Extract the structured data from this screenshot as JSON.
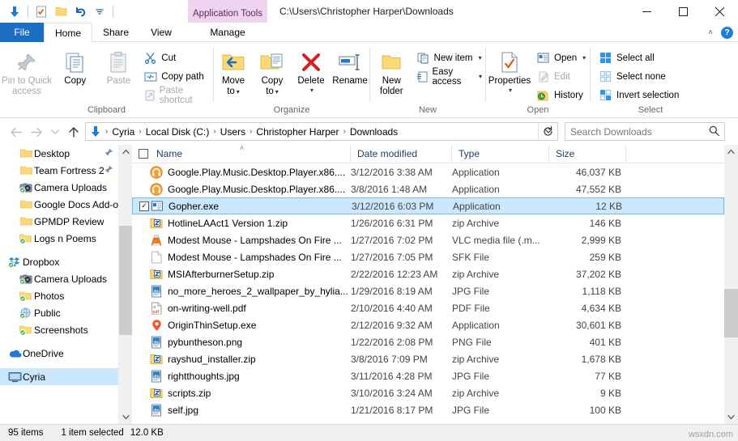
{
  "window": {
    "title": "C:\\Users\\Christopher Harper\\Downloads",
    "app_tools_label": "Application Tools",
    "minimize": "—",
    "maximize": "☐",
    "close": "✕"
  },
  "quick_access": [
    {
      "name": "down-arrow-icon",
      "glyph": "↓"
    },
    {
      "name": "properties-icon",
      "glyph": "☑"
    },
    {
      "name": "new-folder-icon",
      "glyph": "▭"
    },
    {
      "name": "undo-icon",
      "glyph": "↶"
    },
    {
      "name": "customize-icon",
      "glyph": "⌄"
    }
  ],
  "tabs": [
    {
      "label": "File",
      "key": "file"
    },
    {
      "label": "Home",
      "key": "home"
    },
    {
      "label": "Share",
      "key": "share"
    },
    {
      "label": "View",
      "key": "view"
    },
    {
      "label": "Manage",
      "key": "manage"
    }
  ],
  "ribbon_right": {
    "collapse": "˄",
    "help": "?"
  },
  "ribbon": {
    "clipboard": {
      "label": "Clipboard",
      "pin_line1": "Pin to Quick",
      "pin_line2": "access",
      "copy": "Copy",
      "paste": "Paste",
      "cut": "Cut",
      "copy_path": "Copy path",
      "paste_shortcut": "Paste shortcut"
    },
    "organize": {
      "label": "Organize",
      "move_to_line1": "Move",
      "move_to_line2": "to",
      "copy_to_line1": "Copy",
      "copy_to_line2": "to",
      "delete": "Delete",
      "rename": "Rename"
    },
    "new": {
      "label": "New",
      "new_folder_line1": "New",
      "new_folder_line2": "folder",
      "new_item": "New item",
      "easy_access": "Easy access"
    },
    "open": {
      "label": "Open",
      "properties": "Properties",
      "open": "Open",
      "edit": "Edit",
      "history": "History"
    },
    "select": {
      "label": "Select",
      "select_all": "Select all",
      "select_none": "Select none",
      "invert_selection": "Invert selection"
    }
  },
  "addressbar": {
    "back": "←",
    "forward": "→",
    "recent": "⌄",
    "up": "↑",
    "crumbs": [
      "Cyria",
      "Local Disk (C:)",
      "Users",
      "Christopher Harper",
      "Downloads"
    ],
    "separator": "›",
    "dropdown": "⌄",
    "refresh": "↻",
    "search_placeholder": "Search Downloads",
    "search_value": "",
    "search_icon": "⌕"
  },
  "navpane": {
    "items": [
      {
        "label": "Desktop",
        "icon": "folder",
        "pinned": true,
        "indent": 1
      },
      {
        "label": "Team Fortress 2",
        "icon": "folder",
        "pinned": true,
        "indent": 1
      },
      {
        "label": "Camera Uploads",
        "icon": "camera",
        "pinned": false,
        "indent": 1
      },
      {
        "label": "Google Docs Add-ons",
        "icon": "folder",
        "pinned": false,
        "indent": 1
      },
      {
        "label": "GPMDP Review",
        "icon": "folder",
        "pinned": false,
        "indent": 1
      },
      {
        "label": "Logs n Poems",
        "icon": "folder-sync",
        "pinned": false,
        "indent": 1
      },
      {
        "label": "",
        "icon": "spacer",
        "pinned": false,
        "indent": 0
      },
      {
        "label": "Dropbox",
        "icon": "dropbox",
        "pinned": false,
        "indent": 0
      },
      {
        "label": "Camera Uploads",
        "icon": "camera",
        "pinned": false,
        "indent": 1
      },
      {
        "label": "Photos",
        "icon": "folder-sync",
        "pinned": false,
        "indent": 1
      },
      {
        "label": "Public",
        "icon": "globe-sync",
        "pinned": false,
        "indent": 1
      },
      {
        "label": "Screenshots",
        "icon": "folder-sync",
        "pinned": false,
        "indent": 1
      },
      {
        "label": "",
        "icon": "spacer",
        "pinned": false,
        "indent": 0
      },
      {
        "label": "OneDrive",
        "icon": "onedrive",
        "pinned": false,
        "indent": 0
      },
      {
        "label": "",
        "icon": "spacer",
        "pinned": false,
        "indent": 0
      },
      {
        "label": "Cyria",
        "icon": "monitor",
        "pinned": false,
        "indent": 0,
        "selected": true
      }
    ],
    "scroll_up": "˄",
    "scroll_down": "˅"
  },
  "filelist": {
    "columns": [
      "Name",
      "Date modified",
      "Type",
      "Size"
    ],
    "sort_indicator": "˄",
    "scroll_up": "˄",
    "scroll_down": "˅",
    "rows": [
      {
        "name": "Google.Play.Music.Desktop.Player.x86....",
        "date": "3/12/2016 3:38 AM",
        "type": "Application",
        "size": "46,037 KB",
        "icon": "gpmdp",
        "selected": false,
        "checked": false
      },
      {
        "name": "Google.Play.Music.Desktop.Player.x86....",
        "date": "3/8/2016 1:48 AM",
        "type": "Application",
        "size": "47,552 KB",
        "icon": "gpmdp",
        "selected": false,
        "checked": false
      },
      {
        "name": "Gopher.exe",
        "date": "3/12/2016 6:03 PM",
        "type": "Application",
        "size": "12 KB",
        "icon": "exe",
        "selected": true,
        "checked": true
      },
      {
        "name": "HotlineLAAct1 Version 1.zip",
        "date": "1/26/2016 6:31 PM",
        "type": "zip Archive",
        "size": "146 KB",
        "icon": "zip",
        "selected": false,
        "checked": false
      },
      {
        "name": "Modest Mouse - Lampshades On Fire ...",
        "date": "1/27/2016 7:02 PM",
        "type": "VLC media file (.m...",
        "size": "2,999 KB",
        "icon": "vlc",
        "selected": false,
        "checked": false
      },
      {
        "name": "Modest Mouse - Lampshades On Fire ...",
        "date": "1/27/2016 7:05 PM",
        "type": "SFK File",
        "size": "259 KB",
        "icon": "blank",
        "selected": false,
        "checked": false
      },
      {
        "name": "MSIAfterburnerSetup.zip",
        "date": "2/22/2016 12:23 AM",
        "type": "zip Archive",
        "size": "37,202 KB",
        "icon": "zip",
        "selected": false,
        "checked": false
      },
      {
        "name": "no_more_heroes_2_wallpaper_by_hylia...",
        "date": "1/29/2016 8:19 AM",
        "type": "JPG File",
        "size": "1,118 KB",
        "icon": "image",
        "selected": false,
        "checked": false
      },
      {
        "name": "on-writing-well.pdf",
        "date": "2/10/2016 4:40 AM",
        "type": "PDF File",
        "size": "4,634 KB",
        "icon": "pdf",
        "selected": false,
        "checked": false
      },
      {
        "name": "OriginThinSetup.exe",
        "date": "2/12/2016 9:32 AM",
        "type": "Application",
        "size": "30,601 KB",
        "icon": "origin",
        "selected": false,
        "checked": false
      },
      {
        "name": "pybuntheson.png",
        "date": "1/22/2016 2:08 PM",
        "type": "PNG File",
        "size": "401 KB",
        "icon": "image",
        "selected": false,
        "checked": false
      },
      {
        "name": "rayshud_installer.zip",
        "date": "3/8/2016 7:09 PM",
        "type": "zip Archive",
        "size": "1,678 KB",
        "icon": "zip",
        "selected": false,
        "checked": false
      },
      {
        "name": "rightthoughts.jpg",
        "date": "3/11/2016 4:28 PM",
        "type": "JPG File",
        "size": "77 KB",
        "icon": "image",
        "selected": false,
        "checked": false
      },
      {
        "name": "scripts.zip",
        "date": "3/10/2016 3:24 AM",
        "type": "zip Archive",
        "size": "9 KB",
        "icon": "zip",
        "selected": false,
        "checked": false
      },
      {
        "name": "self.jpg",
        "date": "1/21/2016 8:17 PM",
        "type": "JPG File",
        "size": "100 KB",
        "icon": "image",
        "selected": false,
        "checked": false
      }
    ]
  },
  "statusbar": {
    "item_count": "95 items",
    "selection": "1 item selected",
    "selection_size": "12.0 KB",
    "watermark": "wsxdn.com"
  },
  "colors": {
    "accent": "#1b6ec2",
    "selection": "#cce8ff",
    "app_tools": "#efd4ef",
    "folder": "#fcd976"
  }
}
